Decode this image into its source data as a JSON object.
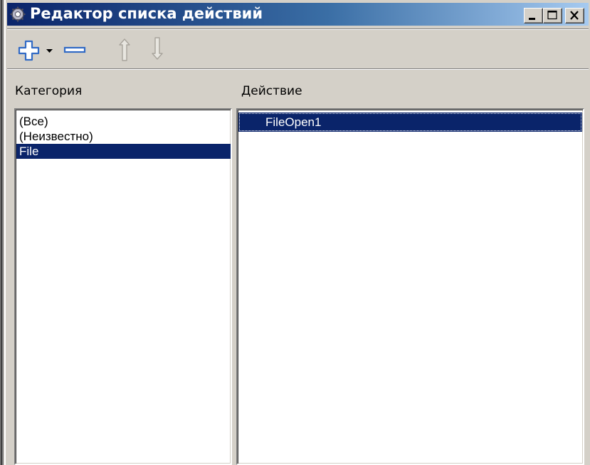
{
  "window": {
    "title": "Редактор списка действий",
    "icon": "app-gear-icon",
    "buttons": {
      "minimize": "minimize-icon",
      "maximize": "maximize-icon",
      "close": "close-icon"
    }
  },
  "toolbar": {
    "items": [
      {
        "name": "add",
        "icon": "plus-icon"
      },
      {
        "name": "add-dropdown",
        "icon": "triangle-down-icon"
      },
      {
        "name": "delete",
        "icon": "minus-icon"
      },
      {
        "name": "move-up",
        "icon": "arrow-up-icon"
      },
      {
        "name": "move-down",
        "icon": "arrow-down-icon"
      }
    ]
  },
  "categories": {
    "label": "Категория",
    "items": [
      "(Все)",
      "(Неизвестно)",
      "File"
    ],
    "selected": "File"
  },
  "actions": {
    "label": "Действие",
    "items": [
      "FileOpen1"
    ],
    "selected": "FileOpen1"
  },
  "colors": {
    "face": "#d4d0c8",
    "selection": "#0a246a",
    "title_gradient_start": "#0a246a",
    "title_gradient_end": "#a6caf0",
    "toolbar_icon": "#316ac5"
  }
}
